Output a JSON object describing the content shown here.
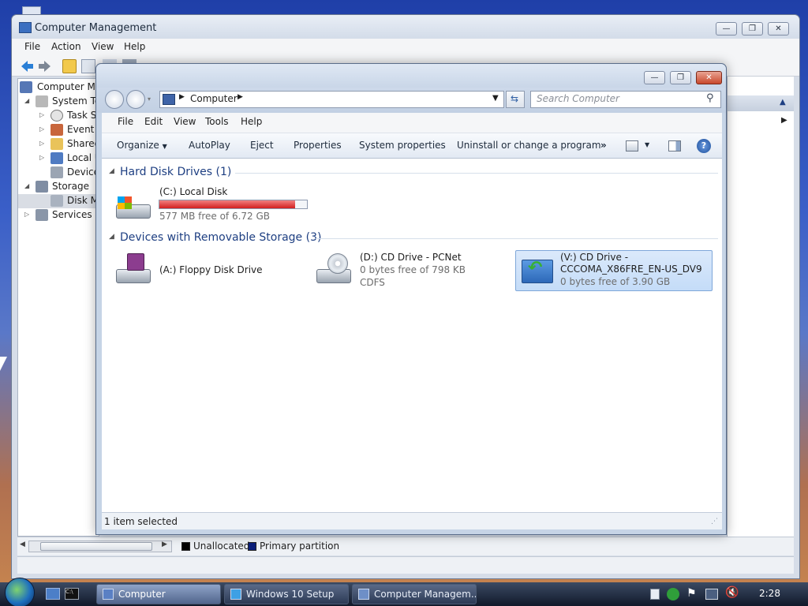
{
  "computer_management": {
    "title": "Computer Management",
    "menu": [
      {
        "label": "File"
      },
      {
        "label": "Action"
      },
      {
        "label": "View"
      },
      {
        "label": "Help"
      }
    ],
    "tree": [
      {
        "label": "Computer Ma",
        "icon": "computer-icon"
      },
      {
        "label": "System To",
        "icon": "tools-icon"
      },
      {
        "label": "Task Sc",
        "icon": "clock-icon"
      },
      {
        "label": "Event V",
        "icon": "event-viewer-icon"
      },
      {
        "label": "Shared",
        "icon": "shared-folder-icon"
      },
      {
        "label": "Local U",
        "icon": "users-icon"
      },
      {
        "label": "Device",
        "icon": "device-icon"
      },
      {
        "label": "Storage",
        "icon": "storage-icon"
      },
      {
        "label": "Disk M",
        "icon": "disk-icon"
      },
      {
        "label": "Services ar",
        "icon": "services-icon"
      }
    ],
    "legend": [
      {
        "label": "Unallocated",
        "color": "#000000"
      },
      {
        "label": "Primary partition",
        "color": "#0a1e7a"
      }
    ]
  },
  "explorer": {
    "address": "Computer",
    "search_placeholder": "Search Computer",
    "menu": [
      {
        "label": "File"
      },
      {
        "label": "Edit"
      },
      {
        "label": "View"
      },
      {
        "label": "Tools"
      },
      {
        "label": "Help"
      }
    ],
    "commands": [
      {
        "label": "Organize"
      },
      {
        "label": "AutoPlay"
      },
      {
        "label": "Eject"
      },
      {
        "label": "Properties"
      },
      {
        "label": "System properties"
      },
      {
        "label": "Uninstall or change a program"
      }
    ],
    "groups": [
      {
        "title": "Hard Disk Drives (1)",
        "items": [
          {
            "name": "(C:) Local Disk",
            "free": "577 MB free of 6.72 GB",
            "used_fraction": 0.92
          }
        ]
      },
      {
        "title": "Devices with Removable Storage (3)",
        "items": [
          {
            "name": "(A:) Floppy Disk Drive"
          },
          {
            "name": "(D:) CD Drive - PCNet",
            "free": "0 bytes free of 798 KB",
            "fs": "CDFS"
          },
          {
            "name": "(V:) CD Drive -",
            "name2": "CCCOMA_X86FRE_EN-US_DV9",
            "free": "0 bytes free of 3.90 GB",
            "selected": true
          }
        ]
      }
    ],
    "status": "1 item selected"
  },
  "taskbar": {
    "buttons": [
      {
        "label": "Computer",
        "active": true
      },
      {
        "label": "Windows 10 Setup"
      },
      {
        "label": "Computer Managem..."
      }
    ],
    "clock": "2:28"
  }
}
